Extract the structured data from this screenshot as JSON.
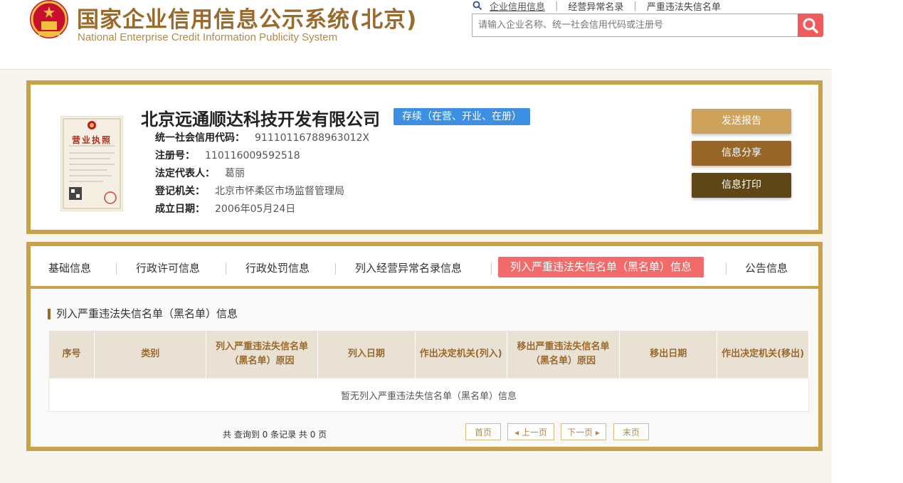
{
  "header": {
    "title_cn": "国家企业信用信息公示系统(北京)",
    "title_en": "National Enterprise Credit Information Publicity System",
    "search_tabs": [
      "企业信用信息",
      "经营异常名录",
      "严重违法失信名单"
    ],
    "search_placeholder": "请输入企业名称、统一社会信用代码或注册号"
  },
  "company": {
    "name": "北京远通顺达科技开发有限公司",
    "status": "存续（在营、开业、在册）",
    "license_caption": "营业执照",
    "fields": [
      {
        "label": "统一社会信用代码：",
        "value": "91110116788963012X"
      },
      {
        "label": "注册号：",
        "value": "110116009592518"
      },
      {
        "label": "法定代表人：",
        "value": "葛丽"
      },
      {
        "label": "登记机关：",
        "value": "北京市怀柔区市场监督管理局"
      },
      {
        "label": "成立日期：",
        "value": "2006年05月24日"
      }
    ]
  },
  "actions": {
    "report": "发送报告",
    "share": "信息分享",
    "print": "信息打印"
  },
  "tabs": [
    "基础信息",
    "行政许可信息",
    "行政处罚信息",
    "列入经营异常名录信息",
    "列入严重违法失信名单（黑名单）信息",
    "公告信息"
  ],
  "section": {
    "title": "列入严重违法失信名单（黑名单）信息",
    "columns": [
      "序号",
      "类别",
      "列入严重违法失信名单（黑名单）原因",
      "列入日期",
      "作出决定机关(列入)",
      "移出严重违法失信名单（黑名单）原因",
      "移出日期",
      "作出决定机关(移出)"
    ],
    "empty_text": "暂无列入严重违法失信名单（黑名单）信息"
  },
  "pager": {
    "summary": "共 查询到 0 条记录 共 0 页",
    "first": "首页",
    "prev": "上一页",
    "next": "下一页",
    "last": "末页"
  },
  "colors": {
    "gold_border": "#c9a14a",
    "status_blue": "#3d8fe3",
    "active_tab": "#f26a6a",
    "search_red": "#f05a5a"
  }
}
